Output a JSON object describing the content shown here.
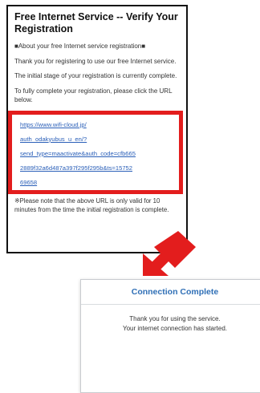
{
  "email": {
    "title": "Free Internet Service -- Verify Your Registration",
    "section_heading": "■About your free Internet service registration■",
    "thanks": "Thank you for registering to use our free Internet service.",
    "stage": "The initial stage of your registration is currently complete.",
    "instruction": "To fully complete your registration, please click the URL below.",
    "url_lines": [
      "https://www.wifi-cloud.jp/",
      "auth_odakyubus_u_en/?",
      "send_type=maactivate&auth_code=cfb665",
      "2889f32a6d487a397f295f295b&ts=15752",
      "69658"
    ],
    "note": "※Please note that the above URL is only valid for 10 minutes from the time the initial registration is complete."
  },
  "dialog": {
    "title": "Connection Complete",
    "line1": "Thank you for using the service.",
    "line2": "Your internet connection has started."
  },
  "colors": {
    "highlight": "#e31d1d",
    "link": "#2a5fb8",
    "dialog_title": "#2f6fb6"
  }
}
